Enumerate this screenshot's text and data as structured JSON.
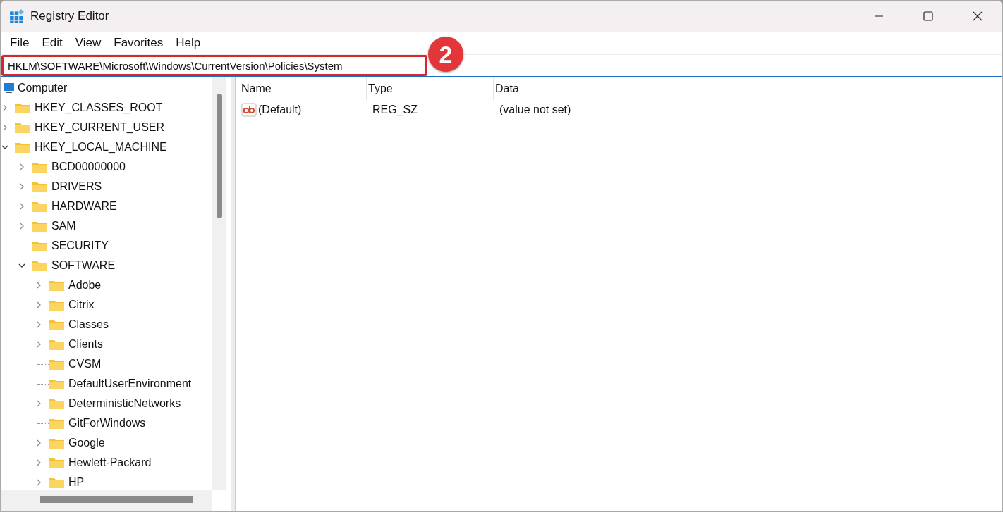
{
  "window": {
    "title": "Registry Editor"
  },
  "menu": [
    "File",
    "Edit",
    "View",
    "Favorites",
    "Help"
  ],
  "address_bar": {
    "value": "HKLM\\SOFTWARE\\Microsoft\\Windows\\CurrentVersion\\Policies\\System"
  },
  "annotation": {
    "step": "2"
  },
  "tree": {
    "root": {
      "label": "Computer",
      "children": [
        {
          "label": "HKEY_CLASSES_ROOT",
          "expandable": true,
          "expanded": false
        },
        {
          "label": "HKEY_CURRENT_USER",
          "expandable": true,
          "expanded": false
        },
        {
          "label": "HKEY_LOCAL_MACHINE",
          "expandable": true,
          "expanded": true,
          "children": [
            {
              "label": "BCD00000000",
              "expandable": true,
              "expanded": false
            },
            {
              "label": "DRIVERS",
              "expandable": true,
              "expanded": false
            },
            {
              "label": "HARDWARE",
              "expandable": true,
              "expanded": false
            },
            {
              "label": "SAM",
              "expandable": true,
              "expanded": false
            },
            {
              "label": "SECURITY",
              "expandable": false,
              "expanded": false
            },
            {
              "label": "SOFTWARE",
              "expandable": true,
              "expanded": true,
              "children": [
                {
                  "label": "Adobe",
                  "expandable": true,
                  "expanded": false
                },
                {
                  "label": "Citrix",
                  "expandable": true,
                  "expanded": false
                },
                {
                  "label": "Classes",
                  "expandable": true,
                  "expanded": false
                },
                {
                  "label": "Clients",
                  "expandable": true,
                  "expanded": false
                },
                {
                  "label": "CVSM",
                  "expandable": false,
                  "expanded": false
                },
                {
                  "label": "DefaultUserEnvironment",
                  "expandable": false,
                  "expanded": false
                },
                {
                  "label": "DeterministicNetworks",
                  "expandable": true,
                  "expanded": false
                },
                {
                  "label": "GitForWindows",
                  "expandable": false,
                  "expanded": false
                },
                {
                  "label": "Google",
                  "expandable": true,
                  "expanded": false
                },
                {
                  "label": "Hewlett-Packard",
                  "expandable": true,
                  "expanded": false
                },
                {
                  "label": "HP",
                  "expandable": true,
                  "expanded": false
                }
              ]
            }
          ]
        }
      ]
    }
  },
  "values": {
    "columns": [
      "Name",
      "Type",
      "Data"
    ],
    "rows": [
      {
        "name": "(Default)",
        "type": "REG_SZ",
        "data": "(value not set)",
        "kind": "string"
      }
    ]
  }
}
